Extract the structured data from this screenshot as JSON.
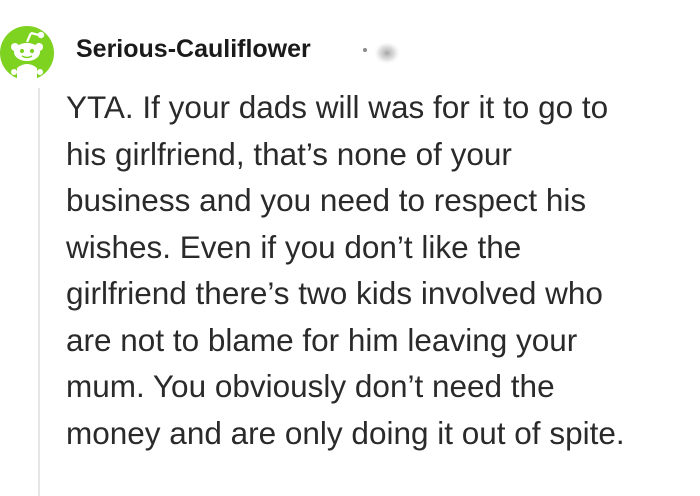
{
  "comment": {
    "avatar_icon": "reddit-snoo-avatar-icon",
    "avatar_color": "#7ed321",
    "author": "Serious-Cauliflower",
    "lines": [
      "YTA. If your dads will was for it to go to",
      "his girlfriend, that’s none of your",
      "business and you need to respect his",
      "wishes. Even if you don’t like the",
      "girlfriend there’s two kids involved who",
      "are not to blame for him leaving your",
      "mum. You obviously don’t need the",
      "money and are only doing it out of spite."
    ]
  }
}
